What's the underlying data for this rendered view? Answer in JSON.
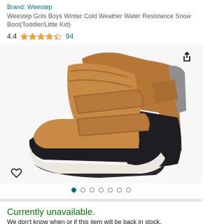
{
  "product": {
    "brand_link": "Brand: Weestep",
    "title": "Weestep Grils Boys Winter Cold Weather Water Resistance Snow Boot(Toddler/Little Kid)",
    "rating": "4.4",
    "rating_stars": 4.4,
    "review_count": "94"
  },
  "gallery": {
    "image_count": 7,
    "active_index": 0,
    "share_icon": "share-icon",
    "wishlist_icon": "heart-outline-icon"
  },
  "availability": {
    "status": "Currently unavailable.",
    "note": "We don't know when or if this item will be back in stock."
  },
  "colors": {
    "link": "#007185",
    "star": "#ffa41c",
    "available_text": "#007600",
    "boot_tan": "#c98a45",
    "boot_sole": "#1e1e22"
  }
}
